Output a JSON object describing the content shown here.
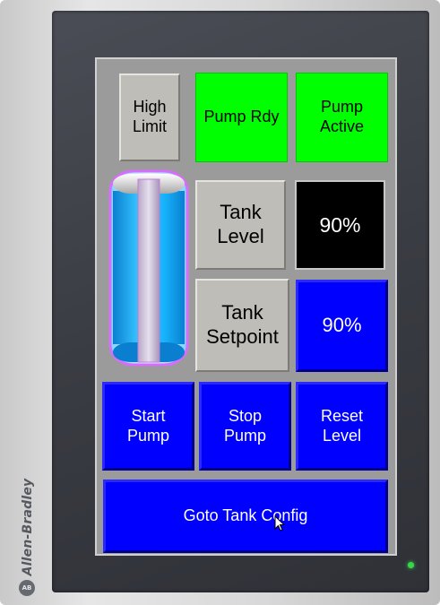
{
  "brand": {
    "name": "Allen-Bradley",
    "logo": "AB"
  },
  "status": {
    "high_limit": "High\nLimit",
    "pump_ready": "Pump Rdy",
    "pump_active": "Pump\nActive"
  },
  "tank": {
    "level_label": "Tank\nLevel",
    "level_value": "90%",
    "setpoint_label": "Tank\nSetpoint",
    "setpoint_value": "90%",
    "fill_fraction": 0.9
  },
  "buttons": {
    "start": "Start\nPump",
    "stop": "Stop\nPump",
    "reset": "Reset\nLevel",
    "goto": "Goto Tank Config"
  },
  "colors": {
    "indicator_on": "#00ff00",
    "button_blue": "#0000ff",
    "tank_liquid": "#17b6ff",
    "led": "#38d64a"
  }
}
